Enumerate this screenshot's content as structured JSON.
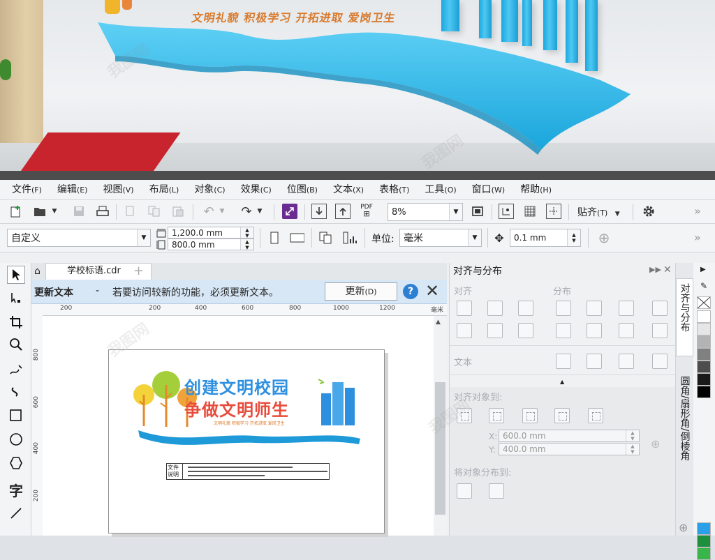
{
  "render": {
    "slogan": "文明礼貌 积极学习 开拓进取 爱岗卫生"
  },
  "menubar": [
    {
      "label": "文件",
      "key": "(F)"
    },
    {
      "label": "编辑",
      "key": "(E)"
    },
    {
      "label": "视图",
      "key": "(V)"
    },
    {
      "label": "布局",
      "key": "(L)"
    },
    {
      "label": "对象",
      "key": "(C)"
    },
    {
      "label": "效果",
      "key": "(C)"
    },
    {
      "label": "位图",
      "key": "(B)"
    },
    {
      "label": "文本",
      "key": "(X)"
    },
    {
      "label": "表格",
      "key": "(T)"
    },
    {
      "label": "工具",
      "key": "(O)"
    },
    {
      "label": "窗口",
      "key": "(W)"
    },
    {
      "label": "帮助",
      "key": "(H)"
    }
  ],
  "toolbar": {
    "zoom": "8%",
    "snap_label": "贴齐",
    "snap_key": "(T)",
    "pdf_label": "PDF",
    "overflow": "»"
  },
  "property_bar": {
    "page_size": "自定义",
    "width": "1,200.0 mm",
    "height": "800.0 mm",
    "units_label": "单位:",
    "units_value": "毫米",
    "nudge": "0.1 mm",
    "overflow": "»"
  },
  "document": {
    "tab_label": "学校标语.cdr",
    "update_title": "更新文本",
    "update_dash": "-",
    "update_message": "若要访问较新的功能，必须更新文本。",
    "update_button": "更新",
    "update_key": "(D)",
    "ruler_unit": "毫米",
    "ruler_top": [
      "200",
      "200",
      "400",
      "600",
      "800",
      "1000",
      "1200"
    ],
    "ruler_left": [
      "800",
      "600",
      "400",
      "200"
    ],
    "artwork": {
      "line1": "创建文明校园",
      "line2": "争做文明师生",
      "subline": "文明礼貌  积极学习  开拓进取  爱岗卫生",
      "note_label_1": "文件",
      "note_label_2": "说明"
    }
  },
  "docker": {
    "title": "对齐与分布",
    "align_label": "对齐",
    "distribute_label": "分布",
    "text_label": "文本",
    "align_to_label": "对齐对象到:",
    "x_label": "X:",
    "x_value": "600.0 mm",
    "y_label": "Y:",
    "y_value": "400.0 mm",
    "distribute_to_label": "将对象分布到:"
  },
  "vtabs": [
    "对齐与分布",
    "圆角/扇形角/倒棱角"
  ],
  "palette": {
    "colors": [
      "#ffffff",
      "#e6e6e6",
      "#b3b3b3",
      "#808080",
      "#4d4d4d",
      "#1a1a1a",
      "#000000",
      "#2aa0e8",
      "#1e8f3c",
      "#39b54a"
    ]
  },
  "colors": {
    "accent_blue": "#2d7fd3",
    "update_bar": "#d7e7f6",
    "banner_cyan": "#27b4e8",
    "slogan_orange": "#d87a2c"
  }
}
